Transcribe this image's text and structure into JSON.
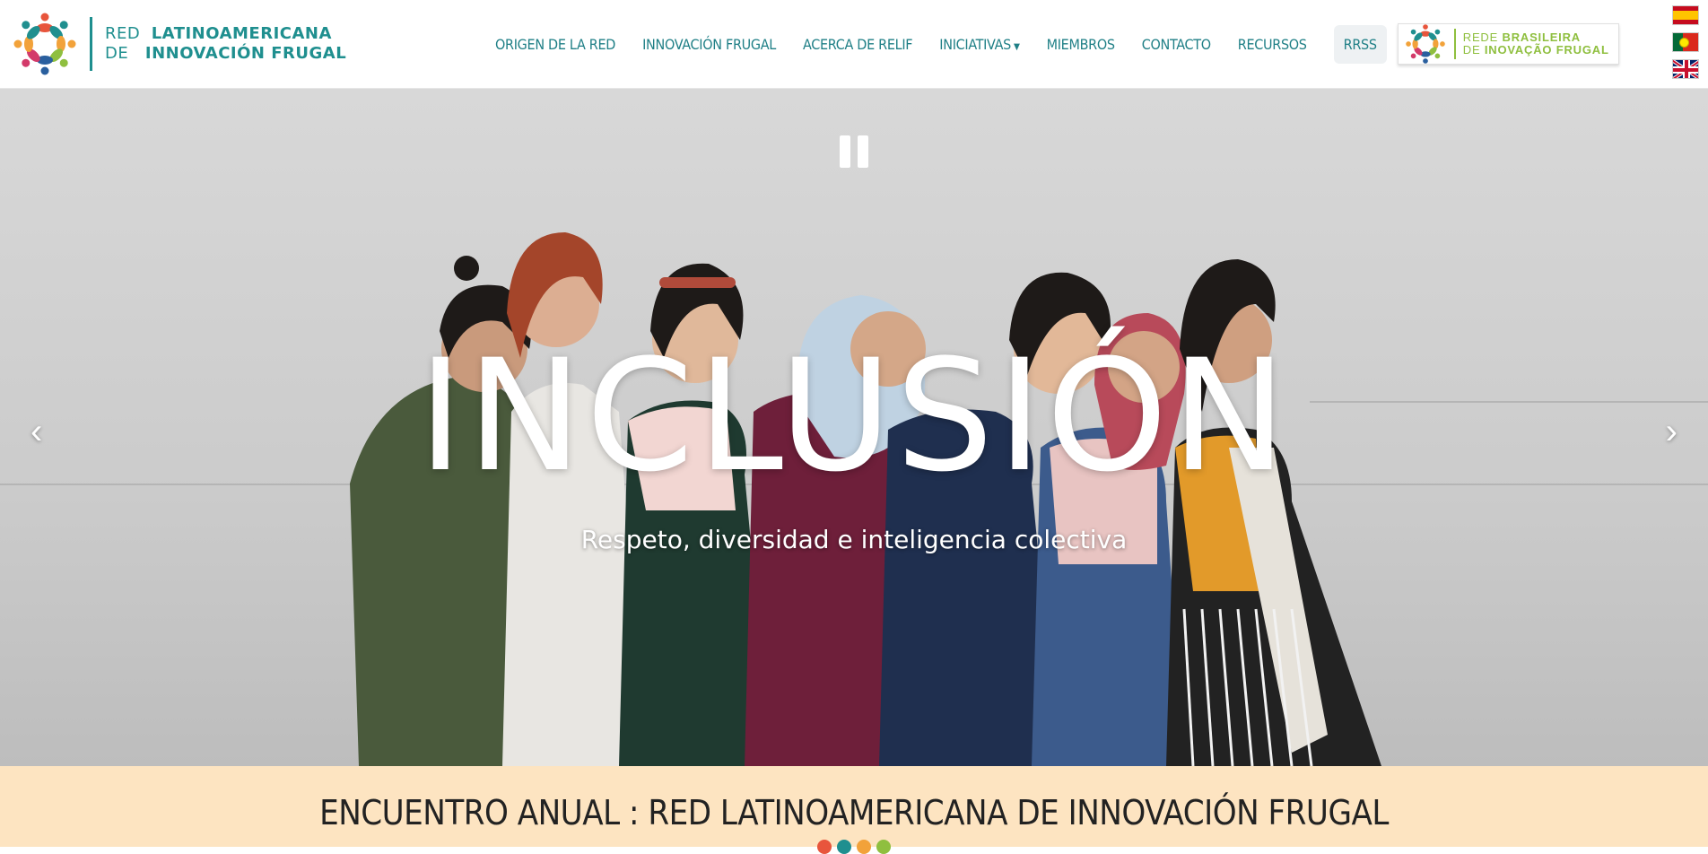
{
  "header": {
    "logo": {
      "line1_light": "RED",
      "line1_bold": "LATINOAMERICANA",
      "line2_light": "DE",
      "line2_bold": "INNOVACIÓN FRUGAL"
    },
    "nav": [
      {
        "label": "ORIGEN DE LA RED"
      },
      {
        "label": "INNOVACIÓN FRUGAL"
      },
      {
        "label": "ACERCA DE RELIF"
      },
      {
        "label": "INICIATIVAS",
        "has_dropdown": true
      },
      {
        "label": "MIEMBROS"
      },
      {
        "label": "CONTACTO"
      },
      {
        "label": "RECURSOS"
      },
      {
        "label": "RRSS"
      }
    ],
    "partner": {
      "line1_light": "REDE",
      "line1_bold": "BRASILEIRA",
      "line2_light": "DE",
      "line2_bold": "INOVAÇÃO FRUGAL"
    },
    "languages": [
      "es-flag",
      "pt-flag",
      "uk-flag"
    ]
  },
  "hero": {
    "title": "INCLUSIÓN",
    "subtitle": "Respeto, diversidad e inteligencia colectiva",
    "prev": "‹",
    "next": "›"
  },
  "banner": {
    "title": "ENCUENTRO ANUAL : RED LATINOAMERICANA DE INNOVACIÓN FRUGAL"
  },
  "colors": {
    "brand_teal": "#1f8f8f",
    "brand_green": "#8fbf3f",
    "banner_bg": "#fde4c1",
    "dot_colors": [
      "#e8553c",
      "#1f8f8f",
      "#f2a23a",
      "#8fbf3f"
    ]
  }
}
